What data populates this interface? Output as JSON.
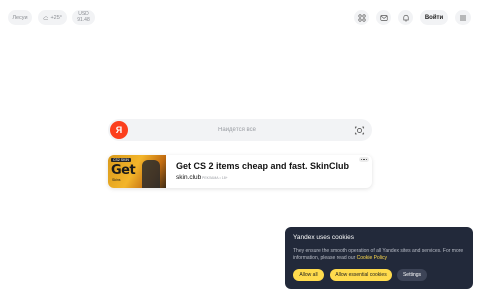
{
  "header": {
    "city": "Лесуи",
    "weather": "+25°",
    "currency_top": "USD",
    "currency_bottom": "91.48",
    "login_label": "Войти"
  },
  "search": {
    "logo_letter": "Я",
    "placeholder": "Найдётся всё"
  },
  "ad": {
    "thumb_tag": "CS2 SKIN",
    "thumb_word": "Get",
    "thumb_sub": "Skins",
    "title": "Get CS 2 items cheap and fast. SkinClub",
    "domain": "skin.club",
    "meta": "РЕКЛАМА • 18+"
  },
  "cookie": {
    "title": "Yandex uses cookies",
    "text_main": "They ensure the smooth operation of all Yandex sites and services. For more information, please read our ",
    "policy_link": "Cookie Policy",
    "allow_all": "Allow all",
    "allow_essential": "Allow essential cookies",
    "settings": "Settings"
  },
  "colors": {
    "brand_red": "#fc3f1d",
    "accent_yellow": "#ffdb4d",
    "banner_bg": "#22293a"
  }
}
